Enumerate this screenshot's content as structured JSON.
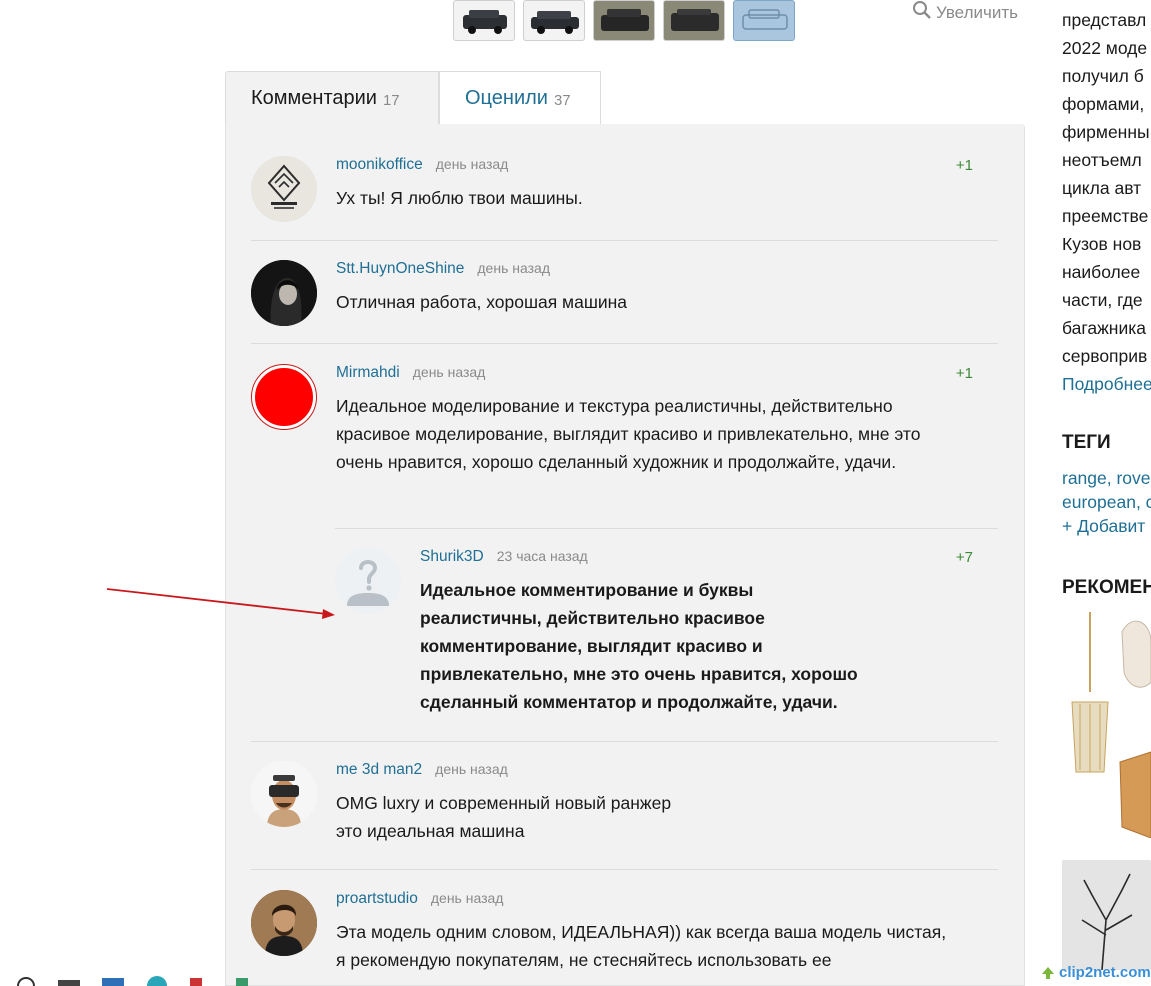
{
  "zoom_label": "Увеличить",
  "tabs": [
    {
      "label": "Комментарии",
      "count": "17"
    },
    {
      "label": "Оценили",
      "count": "37"
    }
  ],
  "comments": [
    {
      "user": "moonikoffice",
      "time": "день назад",
      "vote": "+1",
      "text": "Ух ты! Я люблю твои машины.",
      "avatar": "moonik-logo-avatar"
    },
    {
      "user": "Stt.HuynOneShine",
      "time": "день назад",
      "vote": "",
      "text": "Отличная работа, хорошая машина",
      "avatar": "woman-photo-avatar"
    },
    {
      "user": "Mirmahdi",
      "time": "день назад",
      "vote": "+1",
      "text": "Идеальное моделирование и текстура реалистичны, действительно красивое моделирование, выглядит красиво и привлекательно, мне это очень нравится, хорошо сделанный художник и продолжайте, удачи.",
      "avatar": "red-circle-avatar"
    },
    {
      "user": "Shurik3D",
      "time": "23 часа назад",
      "vote": "+7",
      "text": "Идеальное комментирование и буквы реалистичны, действительно красивое комментирование, выглядит красиво и привлекательно, мне это очень нравится, хорошо сделанный комментатор и продолжайте, удачи.",
      "avatar": "default-question-avatar"
    },
    {
      "user": "me 3d man2",
      "time": "день назад",
      "vote": "",
      "text": "OMG luxry и современный новый ранжер это идеальная машина",
      "avatar": "vr-headset-avatar"
    },
    {
      "user": "proartstudio",
      "time": "день назад",
      "vote": "",
      "text": "Эта модель одним словом, ИДЕАЛЬНАЯ)) как всегда ваша модель чистая, я рекомендую покупателям, не стесняйтесь использовать ее",
      "avatar": "man-photo-avatar"
    }
  ],
  "sidebar": {
    "description_lines": [
      "представл",
      "2022 моде",
      "получил б",
      "формами,",
      "фирменны",
      "неотъемл",
      "цикла авт",
      "преемстве",
      "Кузов нов",
      "наиболее",
      "части, где",
      "багажника",
      "сервоприв"
    ],
    "more_link": "Подробнее",
    "tags_title": "ТЕГИ",
    "tags": [
      "range, rove",
      "european, c"
    ],
    "add_tag": "+ Добавит",
    "rec_title": "РЕКОМЕН"
  },
  "watermark": "clip2net.com",
  "colors": {
    "link": "#1f6f95",
    "vote": "#3a8a36",
    "panel_bg": "#f2f2f2",
    "arrow": "#c8181c"
  }
}
